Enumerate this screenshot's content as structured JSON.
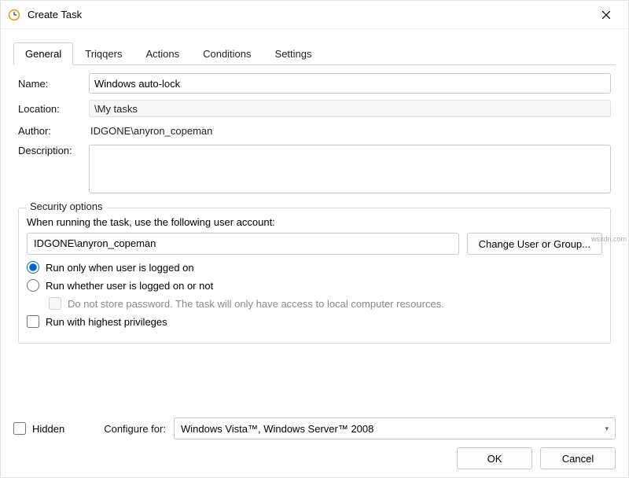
{
  "window": {
    "title": "Create Task"
  },
  "tabs": {
    "general": "General",
    "triggers": "Triqqers",
    "actions": "Actions",
    "conditions": "Conditions",
    "settings": "Settings"
  },
  "fields": {
    "name_label": "Name:",
    "name_value": "Windows auto-lock",
    "location_label": "Location:",
    "location_value": "\\My tasks",
    "author_label": "Author:",
    "author_value": "IDGONE\\anyron_copeman",
    "description_label": "Description:",
    "description_value": ""
  },
  "security": {
    "group_title": "Security options",
    "prompt": "When running the task, use the following user account:",
    "account": "IDGONE\\anyron_copeman",
    "change_button": "Change User or Group...",
    "radio_logged_on": "Run only when user is logged on",
    "radio_not_logged_on": "Run whether user is logged on or not",
    "no_store_password": "Do not store password.  The task will only have access to local computer resources.",
    "highest_priv": "Run with highest privileges"
  },
  "footer": {
    "hidden_label": "Hidden",
    "configure_for_label": "Configure for:",
    "configure_for_value": "Windows Vista™, Windows Server™ 2008",
    "ok": "OK",
    "cancel": "Cancel"
  },
  "watermark": "wsxdn.com"
}
